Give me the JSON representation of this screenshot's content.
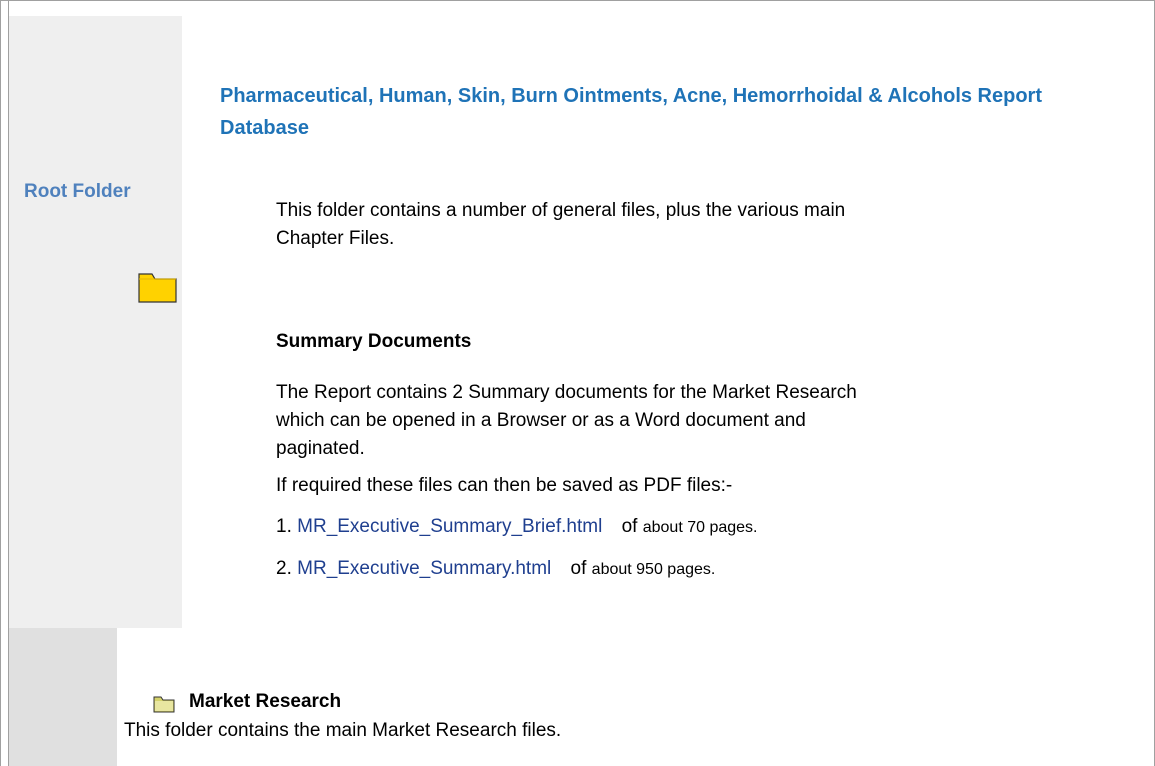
{
  "title": "Pharmaceutical, Human, Skin, Burn Ointments, Acne, Hemorrhoidal & Alcohols Report Database",
  "sidebar": {
    "root_label": "Root Folder",
    "folder_icon": "folder-icon"
  },
  "intro": "This folder contains a number of general files, plus the various main Chapter Files.",
  "summary": {
    "heading": "Summary Documents",
    "description": "The Report contains 2 Summary documents for the Market Research which can be opened in a Browser or as a Word document and paginated.",
    "pdf_note": "If required these files can then be saved as PDF files:-",
    "items": [
      {
        "number": "1.",
        "link": "MR_Executive_Summary_Brief.html",
        "of": "of",
        "rest": "about 70 pages."
      },
      {
        "number": "2.",
        "link": "MR_Executive_Summary.html",
        "of": "of",
        "rest": "about 950 pages."
      }
    ]
  },
  "market_research": {
    "heading": "Market Research",
    "description": "This folder contains the main Market Research files.",
    "folder_icon": "folder-icon"
  },
  "colors": {
    "title": "#1f73b7",
    "root_label": "#4f81bd",
    "link": "#1f3f8f",
    "folder_yellow": "#ffd200",
    "sidebar_light": "#efefef",
    "sidebar_dark": "#e0e0e0"
  }
}
